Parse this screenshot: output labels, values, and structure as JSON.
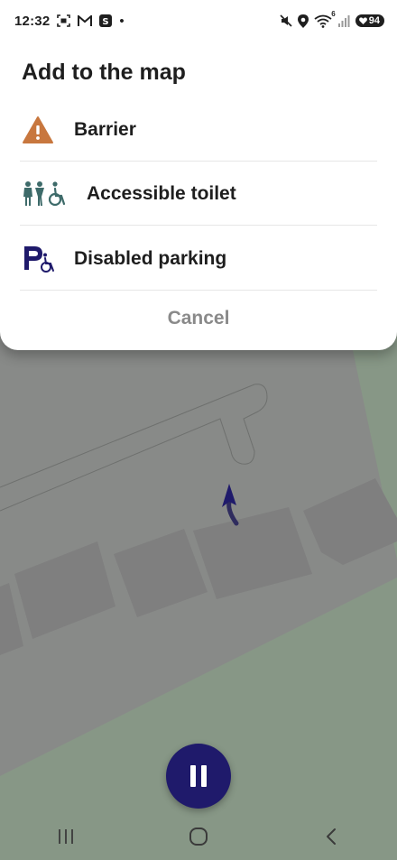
{
  "status_bar": {
    "time": "12:32",
    "battery": "94",
    "network_label": "6",
    "dot": "•"
  },
  "sheet": {
    "title": "Add to the map",
    "options": [
      {
        "label": "Barrier",
        "icon": "warning-triangle-icon"
      },
      {
        "label": "Accessible toilet",
        "icon": "accessible-toilet-icon"
      },
      {
        "label": "Disabled parking",
        "icon": "disabled-parking-icon"
      }
    ],
    "cancel_label": "Cancel"
  },
  "fab": {
    "icon": "pause-icon"
  },
  "nav_bar": {
    "items": [
      {
        "icon": "recent-apps-icon"
      },
      {
        "icon": "home-icon"
      },
      {
        "icon": "back-icon"
      }
    ]
  },
  "colors": {
    "accent": "#1f1a6b",
    "barrier_icon": "#c8773e",
    "toilet_icon": "#3e6b6a",
    "parking_icon": "#1f1a6b",
    "map_background": "#888a88",
    "map_green": "#879786",
    "map_building": "#7f7f7f"
  }
}
